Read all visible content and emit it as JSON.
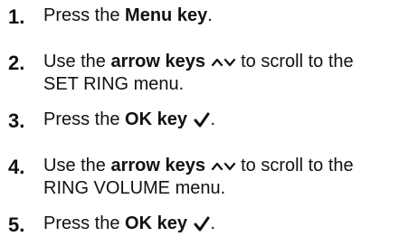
{
  "instructions": {
    "steps": [
      {
        "number": "1.",
        "prefix": "Press the ",
        "bold": "Menu key",
        "suffix": "."
      },
      {
        "number": "2.",
        "prefix": "Use the ",
        "bold": "arrow keys",
        "icons": [
          "caret-up-icon",
          "caret-down-icon"
        ],
        "suffix_line1": " to scroll to the",
        "line2": "SET RING menu."
      },
      {
        "number": "3.",
        "prefix": "Press the ",
        "bold": "OK key",
        "icon": "checkmark-icon",
        "suffix": "."
      },
      {
        "number": "4.",
        "prefix": "Use the ",
        "bold": "arrow keys",
        "icons": [
          "caret-up-icon",
          "caret-down-icon"
        ],
        "suffix_line1": " to scroll to the",
        "line2": "RING VOLUME menu."
      },
      {
        "number": "5.",
        "prefix": "Press the ",
        "bold": "OK key",
        "icon": "checkmark-icon",
        "suffix": "."
      }
    ]
  }
}
